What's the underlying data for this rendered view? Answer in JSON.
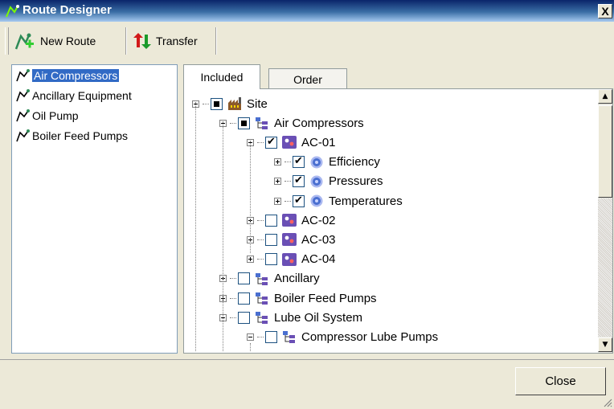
{
  "window": {
    "title": "Route Designer",
    "close_glyph": "X"
  },
  "toolbar": {
    "new_route_label": "New Route",
    "transfer_label": "Transfer"
  },
  "routes": [
    {
      "label": "Air Compressors",
      "selected": true
    },
    {
      "label": "Ancillary Equipment",
      "selected": false
    },
    {
      "label": "Oil Pump",
      "selected": false
    },
    {
      "label": "Boiler Feed Pumps",
      "selected": false
    }
  ],
  "tabs": [
    {
      "label": "Included",
      "active": true
    },
    {
      "label": "Order",
      "active": false
    }
  ],
  "tree": [
    {
      "label": "Site",
      "level": 0,
      "expander": "minus",
      "check": "partial",
      "icon": "factory-icon"
    },
    {
      "label": "Air Compressors",
      "level": 1,
      "expander": "minus",
      "check": "partial",
      "icon": "group-icon"
    },
    {
      "label": "AC-01",
      "level": 2,
      "expander": "minus",
      "check": "checked",
      "icon": "equipment-icon"
    },
    {
      "label": "Efficiency",
      "level": 3,
      "expander": "plus",
      "check": "checked",
      "icon": "measurement-icon"
    },
    {
      "label": "Pressures",
      "level": 3,
      "expander": "plus",
      "check": "checked",
      "icon": "measurement-icon"
    },
    {
      "label": "Temperatures",
      "level": 3,
      "expander": "plus",
      "check": "checked",
      "icon": "measurement-icon"
    },
    {
      "label": "AC-02",
      "level": 2,
      "expander": "plus",
      "check": "unchecked",
      "icon": "equipment-icon"
    },
    {
      "label": "AC-03",
      "level": 2,
      "expander": "plus",
      "check": "unchecked",
      "icon": "equipment-icon"
    },
    {
      "label": "AC-04",
      "level": 2,
      "expander": "plus",
      "check": "unchecked",
      "icon": "equipment-icon"
    },
    {
      "label": "Ancillary",
      "level": 1,
      "expander": "plus",
      "check": "unchecked",
      "icon": "group-icon"
    },
    {
      "label": "Boiler Feed Pumps",
      "level": 1,
      "expander": "plus",
      "check": "unchecked",
      "icon": "group-icon"
    },
    {
      "label": "Lube Oil System",
      "level": 1,
      "expander": "minus",
      "check": "unchecked",
      "icon": "group-icon"
    },
    {
      "label": "Compressor Lube Pumps",
      "level": 2,
      "expander": "minus",
      "check": "unchecked",
      "icon": "group-icon"
    }
  ],
  "footer": {
    "close_label": "Close"
  },
  "colors": {
    "selection": "#316ac5",
    "title_bar": "#0a246a",
    "face": "#ece9d8",
    "equipment_icon": "#6a4fb5",
    "measurement_icon": "#4a6fd0"
  }
}
